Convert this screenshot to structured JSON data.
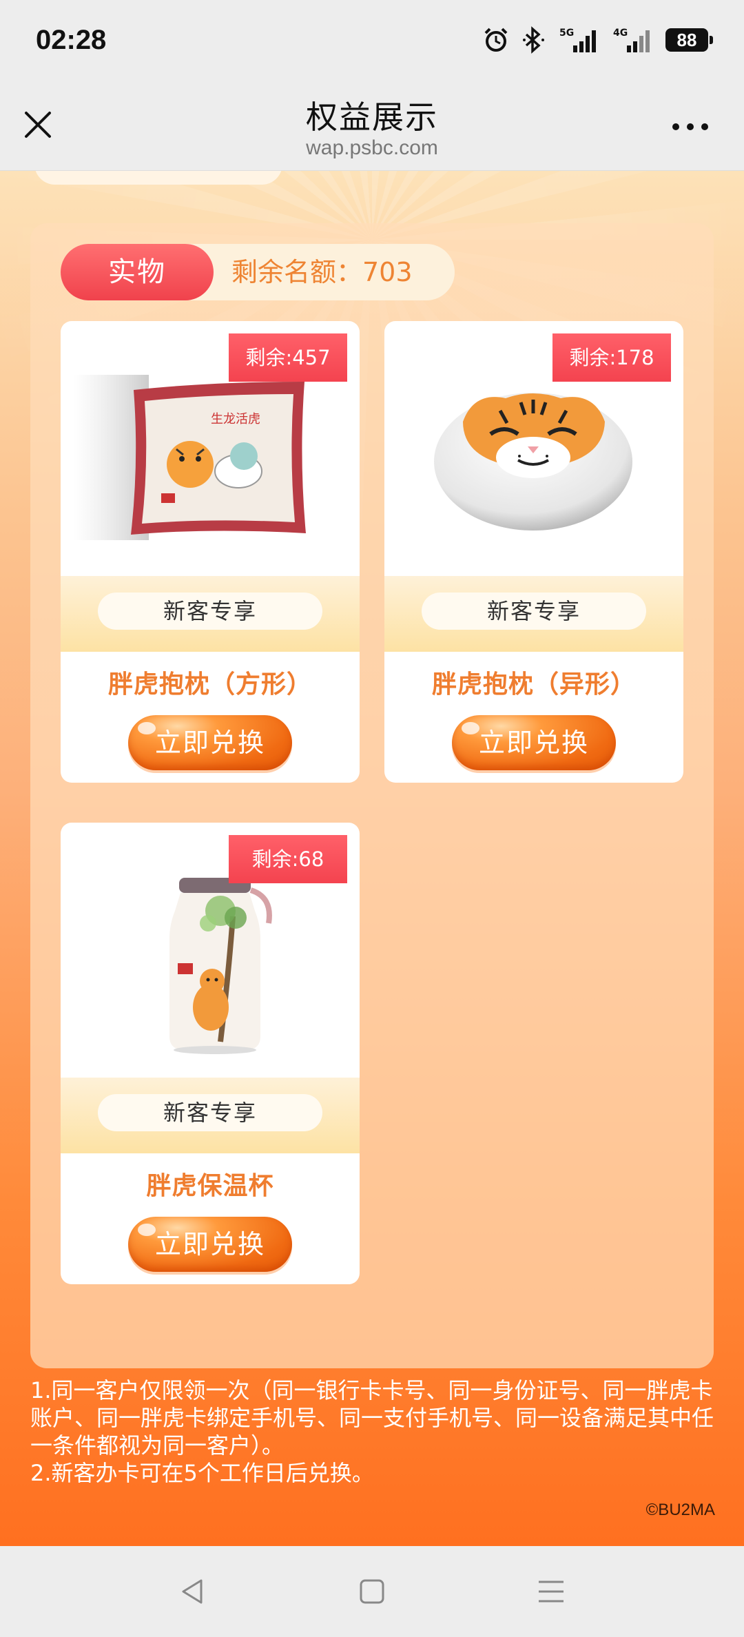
{
  "status_bar": {
    "time": "02:28",
    "network_1": "5G",
    "network_2": "4G",
    "battery": "88",
    "icons": [
      "alarm-icon",
      "bluetooth-icon",
      "signal-5g-icon",
      "signal-4g-icon",
      "battery-icon"
    ]
  },
  "nav": {
    "title": "权益展示",
    "url": "wap.psbc.com",
    "close_icon": "close-icon",
    "more_icon": "more-icon"
  },
  "panel": {
    "category_tag": "实物",
    "remaining_total": "剩余名额：703"
  },
  "products": [
    {
      "name": "胖虎抱枕（方形）",
      "remaining": "剩余:457",
      "tag": "新客专享",
      "button": "立即兑换",
      "image": "square-tiger-pillow-image"
    },
    {
      "name": "胖虎抱枕（异形）",
      "remaining": "剩余:178",
      "tag": "新客专享",
      "button": "立即兑换",
      "image": "tiger-face-pillow-image"
    },
    {
      "name": "胖虎保温杯",
      "remaining": "剩余:68",
      "tag": "新客专享",
      "button": "立即兑换",
      "image": "tiger-thermos-cup-image"
    }
  ],
  "rules": {
    "line1": "1.同一客户仅限领一次（同一银行卡卡号、同一身份证号、同一胖虎卡账户、同一胖虎卡绑定手机号、同一支付手机号、同一设备满足其中任一条件都视为同一客户）。",
    "line2": "2.新客办卡可在5个工作日后兑换。"
  },
  "copyright": "©BU2MA",
  "bottom_nav": [
    "back-icon",
    "home-icon",
    "menu-icon"
  ],
  "colors": {
    "accent_red": "#f0424c",
    "accent_orange": "#ef7d2f",
    "page_bottom": "#ff7020"
  }
}
